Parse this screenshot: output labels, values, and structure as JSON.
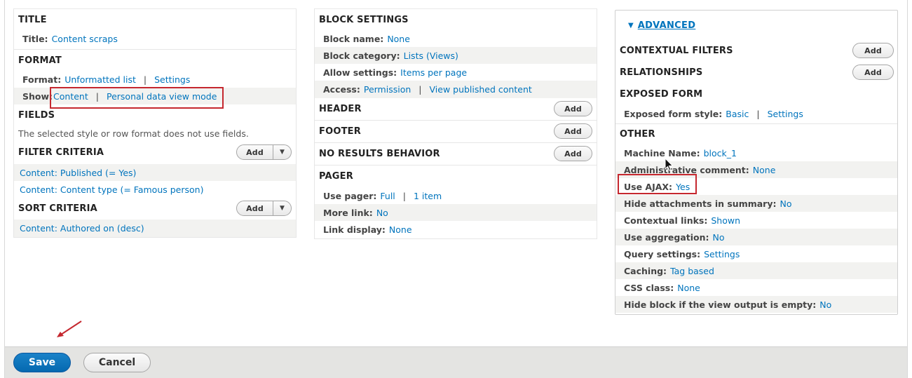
{
  "col1": {
    "title": {
      "heading": "TITLE",
      "label": "Title:",
      "value": "Content scraps"
    },
    "format": {
      "heading": "FORMAT",
      "format_label": "Format:",
      "format_value": "Unformatted list",
      "format_sep": "|",
      "format_settings": "Settings",
      "show_label": "Show:",
      "show_value": "Content",
      "show_sep": "|",
      "show_mode": "Personal data view mode"
    },
    "fields": {
      "heading": "FIELDS",
      "note": "The selected style or row format does not use fields."
    },
    "filter": {
      "heading": "FILTER CRITERIA",
      "add": "Add",
      "items": [
        "Content: Published (= Yes)",
        "Content: Content type (= Famous person)"
      ]
    },
    "sort": {
      "heading": "SORT CRITERIA",
      "add": "Add",
      "items": [
        "Content: Authored on (desc)"
      ]
    }
  },
  "col2": {
    "block": {
      "heading": "BLOCK SETTINGS",
      "name_label": "Block name:",
      "name_value": "None",
      "cat_label": "Block category:",
      "cat_value": "Lists (Views)",
      "allow_label": "Allow settings:",
      "allow_value": "Items per page",
      "access_label": "Access:",
      "access_value": "Permission",
      "access_sep": "|",
      "access_extra": "View published content"
    },
    "header": {
      "heading": "HEADER",
      "add": "Add"
    },
    "footer": {
      "heading": "FOOTER",
      "add": "Add"
    },
    "noresults": {
      "heading": "NO RESULTS BEHAVIOR",
      "add": "Add"
    },
    "pager": {
      "heading": "PAGER",
      "use_label": "Use pager:",
      "use_value": "Full",
      "use_sep": "|",
      "use_extra": "1 item",
      "more_label": "More link:",
      "more_value": "No",
      "link_label": "Link display:",
      "link_value": "None"
    }
  },
  "col3": {
    "advanced": "ADVANCED",
    "contextual": {
      "heading": "CONTEXTUAL FILTERS",
      "add": "Add"
    },
    "relationships": {
      "heading": "RELATIONSHIPS",
      "add": "Add"
    },
    "exposed": {
      "heading": "EXPOSED FORM",
      "style_label": "Exposed form style:",
      "style_value": "Basic",
      "style_sep": "|",
      "style_settings": "Settings"
    },
    "other": {
      "heading": "OTHER",
      "rows": [
        {
          "label": "Machine Name:",
          "value": "block_1"
        },
        {
          "label": "Administrative comment:",
          "value": "None"
        },
        {
          "label": "Use AJAX:",
          "value": "Yes"
        },
        {
          "label": "Hide attachments in summary:",
          "value": "No"
        },
        {
          "label": "Contextual links:",
          "value": "Shown"
        },
        {
          "label": "Use aggregation:",
          "value": "No"
        },
        {
          "label": "Query settings:",
          "value": "Settings"
        },
        {
          "label": "Caching:",
          "value": "Tag based"
        },
        {
          "label": "CSS class:",
          "value": "None"
        },
        {
          "label": "Hide block if the view output is empty:",
          "value": "No"
        }
      ]
    }
  },
  "actions": {
    "save": "Save",
    "cancel": "Cancel"
  },
  "colors": {
    "link": "#0074bd",
    "primary": "#0569b0",
    "annotation": "#c5282f"
  }
}
